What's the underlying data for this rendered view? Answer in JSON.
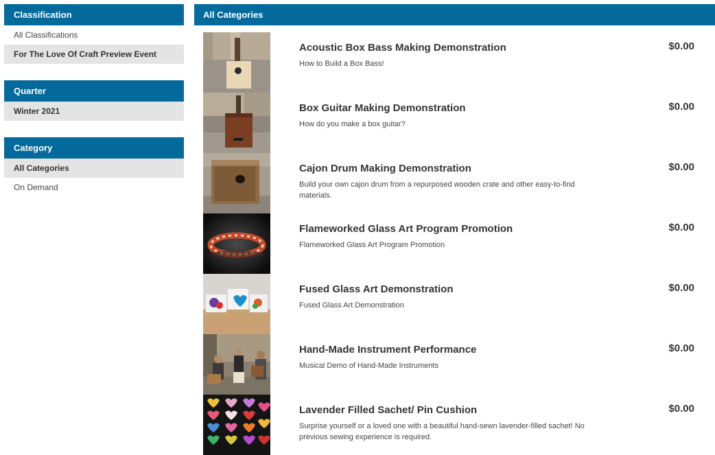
{
  "sidebar": {
    "classification": {
      "title": "Classification",
      "items": [
        {
          "label": "All Classifications",
          "active": false
        },
        {
          "label": "For The Love Of Craft Preview Event",
          "active": true
        }
      ]
    },
    "quarter": {
      "title": "Quarter",
      "items": [
        {
          "label": "Winter 2021",
          "active": true
        }
      ]
    },
    "category": {
      "title": "Category",
      "items": [
        {
          "label": "All Categories",
          "active": true
        },
        {
          "label": "On Demand",
          "active": false
        }
      ]
    }
  },
  "main": {
    "title": "All Categories",
    "items": [
      {
        "title": "Acoustic Box Bass Making Demonstration",
        "desc": "How to Build a Box Bass!",
        "price": "$0.00",
        "image": "box-bass-photo"
      },
      {
        "title": "Box Guitar Making Demonstration",
        "desc": "How do you make a box guitar?",
        "price": "$0.00",
        "image": "box-guitar-photo"
      },
      {
        "title": "Cajon Drum Making Demonstration",
        "desc": "Build your own cajon drum from a repurposed wooden crate and other easy-to-find materials.",
        "price": "$0.00",
        "image": "cajon-drum-photo"
      },
      {
        "title": "Flameworked Glass Art Program Promotion",
        "desc": "Flameworked Glass Art Program Promotion",
        "price": "$0.00",
        "image": "glass-bead-bracelet-photo"
      },
      {
        "title": "Fused Glass Art Demonstration",
        "desc": "Fused Glass Art Demonstration",
        "price": "$0.00",
        "image": "fused-glass-hearts-photo"
      },
      {
        "title": "Hand-Made Instrument Performance",
        "desc": "Musical Demo of Hand-Made Instruments",
        "price": "$0.00",
        "image": "musicians-photo"
      },
      {
        "title": "Lavender Filled Sachet/ Pin Cushion",
        "desc": "Surprise yourself or a loved one with a beautiful hand-sewn lavender-filled sachet! No previous sewing experience is required.",
        "price": "$0.00",
        "image": "heart-sachets-photo"
      }
    ]
  },
  "colors": {
    "header_bg": "#046a9c",
    "active_bg": "#e4e4e4"
  }
}
